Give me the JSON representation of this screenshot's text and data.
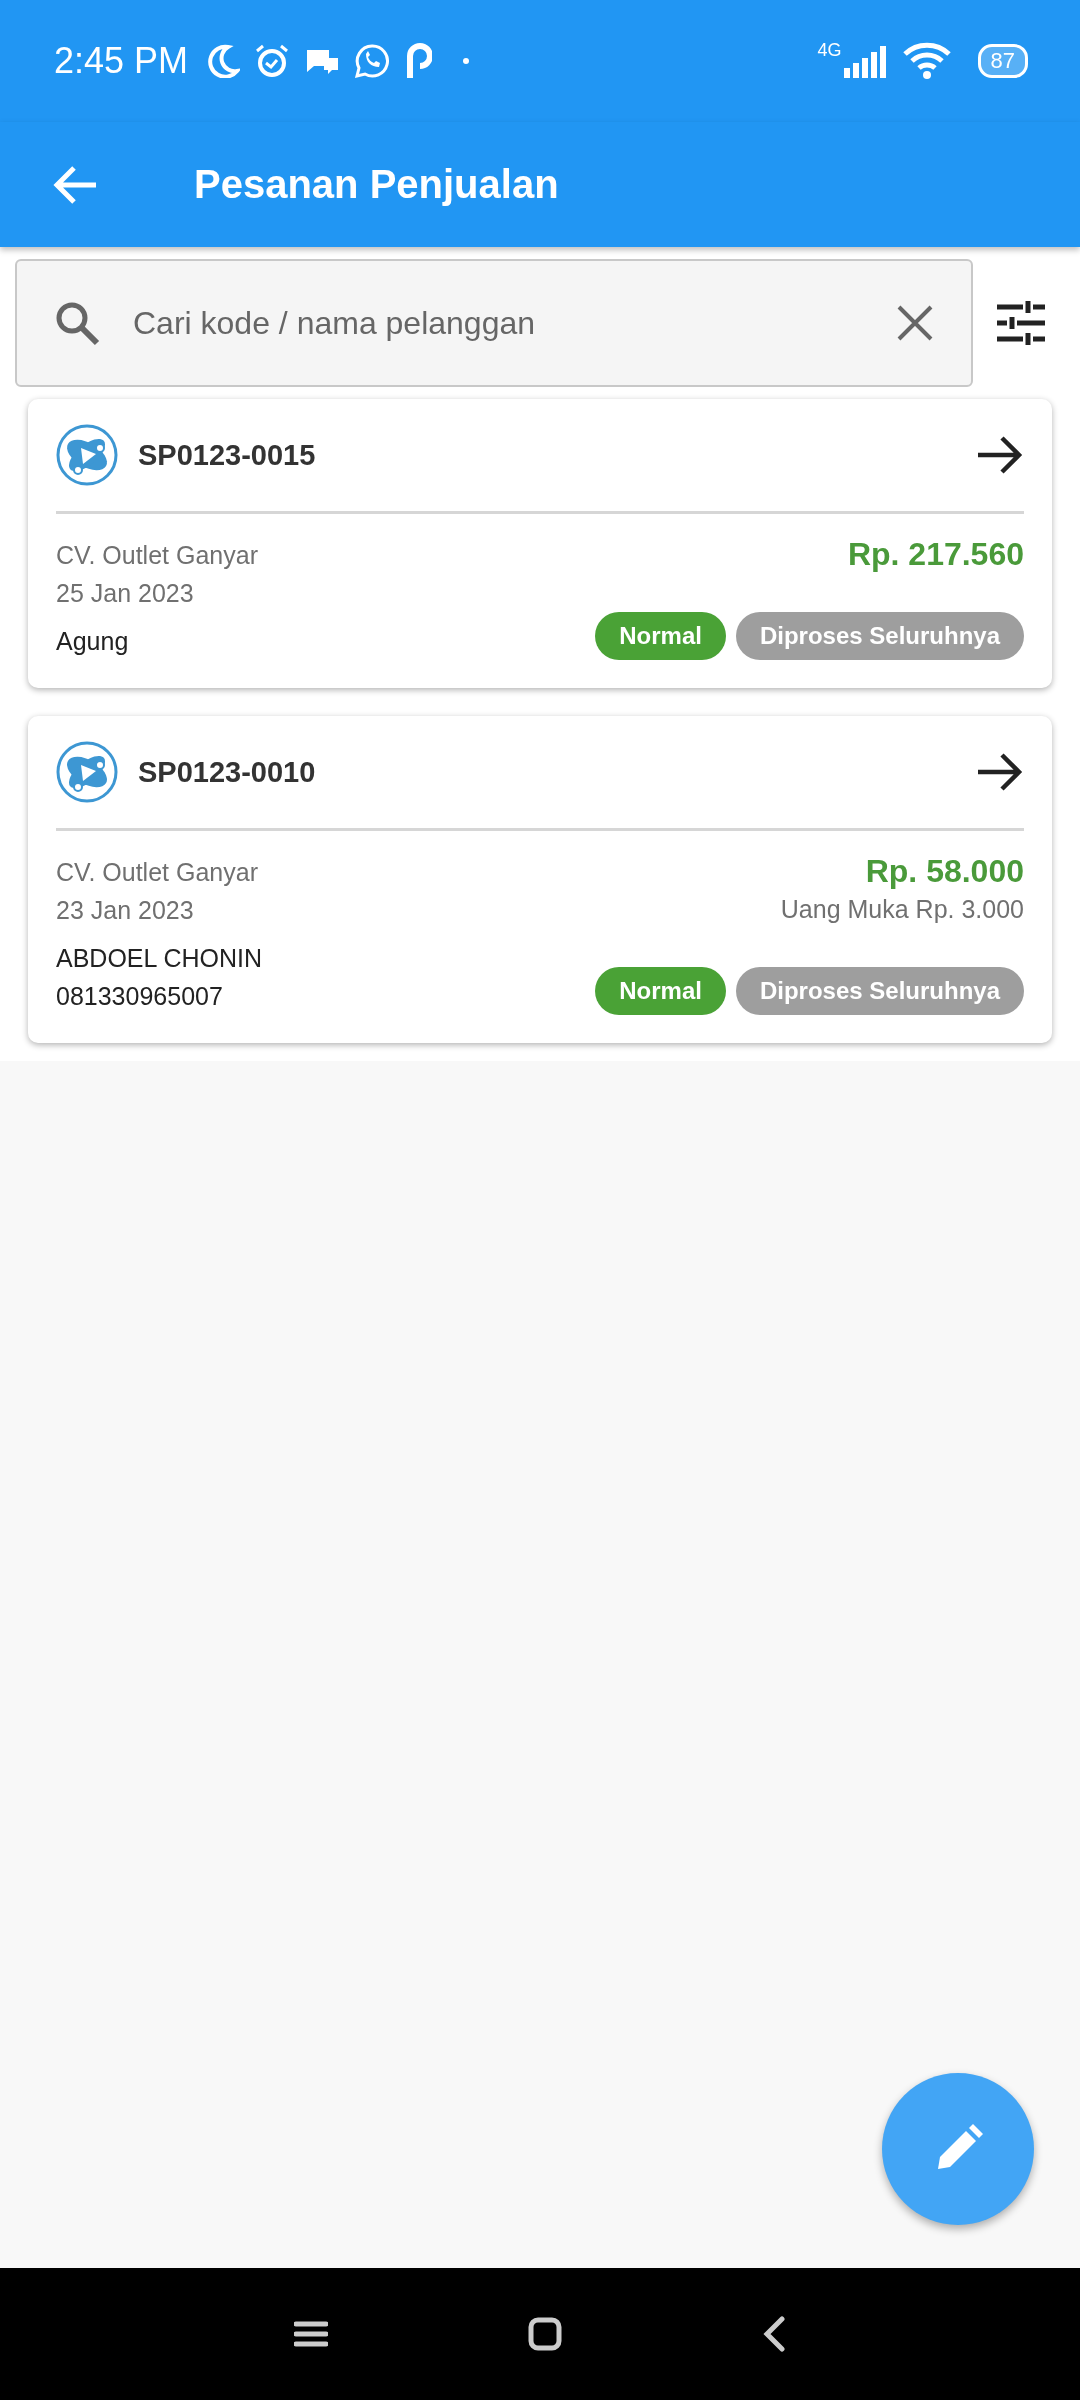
{
  "status_bar": {
    "time": "2:45 PM",
    "network": "4G",
    "battery": "87"
  },
  "app_bar": {
    "title": "Pesanan Penjualan"
  },
  "search": {
    "placeholder": "Cari kode / nama pelanggan"
  },
  "orders": [
    {
      "code": "SP0123-0015",
      "outlet": "CV. Outlet Ganyar",
      "date": "25 Jan 2023",
      "customer_lines": [
        "Agung"
      ],
      "amount": "Rp. 217.560",
      "tags": [
        {
          "label": "Normal",
          "color": "#4aa236"
        },
        {
          "label": "Diproses Seluruhnya",
          "color": "#9e9e9e"
        }
      ]
    },
    {
      "code": "SP0123-0010",
      "outlet": "CV. Outlet Ganyar",
      "date": "23 Jan 2023",
      "customer_lines": [
        "ABDOEL CHONIN",
        "081330965007"
      ],
      "amount": "Rp. 58.000",
      "down_payment": "Uang Muka Rp. 3.000",
      "tags": [
        {
          "label": "Normal",
          "color": "#4aa236"
        },
        {
          "label": "Diproses Seluruhnya",
          "color": "#9e9e9e"
        }
      ]
    }
  ]
}
